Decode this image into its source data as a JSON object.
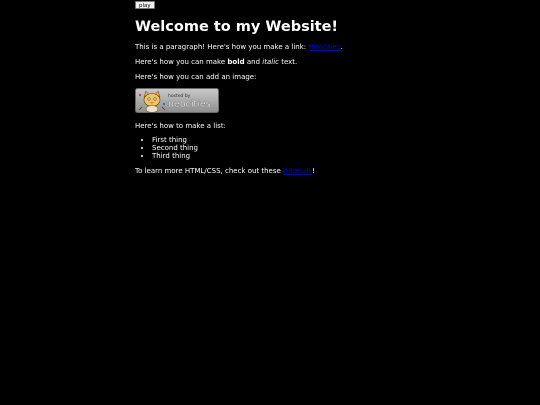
{
  "play_button": "play",
  "heading": "Welcome to my Website!",
  "paragraph_link": {
    "before": "This is a paragraph! Here's how you make a link: ",
    "link_text": "Neocities",
    "after": "."
  },
  "paragraph_format": {
    "before": "Here's how you can make ",
    "bold": "bold",
    "middle": " and ",
    "italic": "italic",
    "after": " text."
  },
  "paragraph_image": "Here's how you can add an image:",
  "badge": {
    "top_text": "hosted by",
    "brand": "neocities"
  },
  "paragraph_list": "Here's how to make a list:",
  "list_items": [
    "First thing",
    "Second thing",
    "Third thing"
  ],
  "paragraph_learn": {
    "before": "To learn more HTML/CSS, check out these ",
    "link_text": "tutorials",
    "after": "!"
  },
  "colors": {
    "background": "#000000",
    "text": "#ffffff",
    "link": "#0000ee"
  }
}
